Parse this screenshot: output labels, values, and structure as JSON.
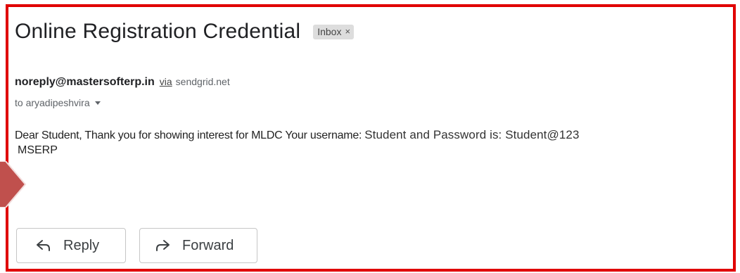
{
  "email": {
    "subject": "Online Registration Credential",
    "label": "Inbox",
    "label_close": "×",
    "sender_email": "noreply@mastersofterp.in",
    "via_text": "via",
    "via_domain": "sendgrid.net",
    "recipient_line": "to aryadipeshvira",
    "body_part1": "Dear Student, Thank you for showing interest for MLDC Your username:",
    "body_part2": "Student and Password is: Student@123",
    "body_part3": "MSERP"
  },
  "actions": {
    "reply_label": "Reply",
    "forward_label": "Forward"
  },
  "icons": {
    "reply": "reply-arrow-icon",
    "forward": "forward-arrow-icon",
    "recipient_details": "caret-down-icon",
    "callout": "callout-arrow-icon"
  },
  "colors": {
    "highlight_border": "#e00000",
    "callout_arrow": "#c0504d",
    "label_chip_bg": "#dddddd"
  }
}
